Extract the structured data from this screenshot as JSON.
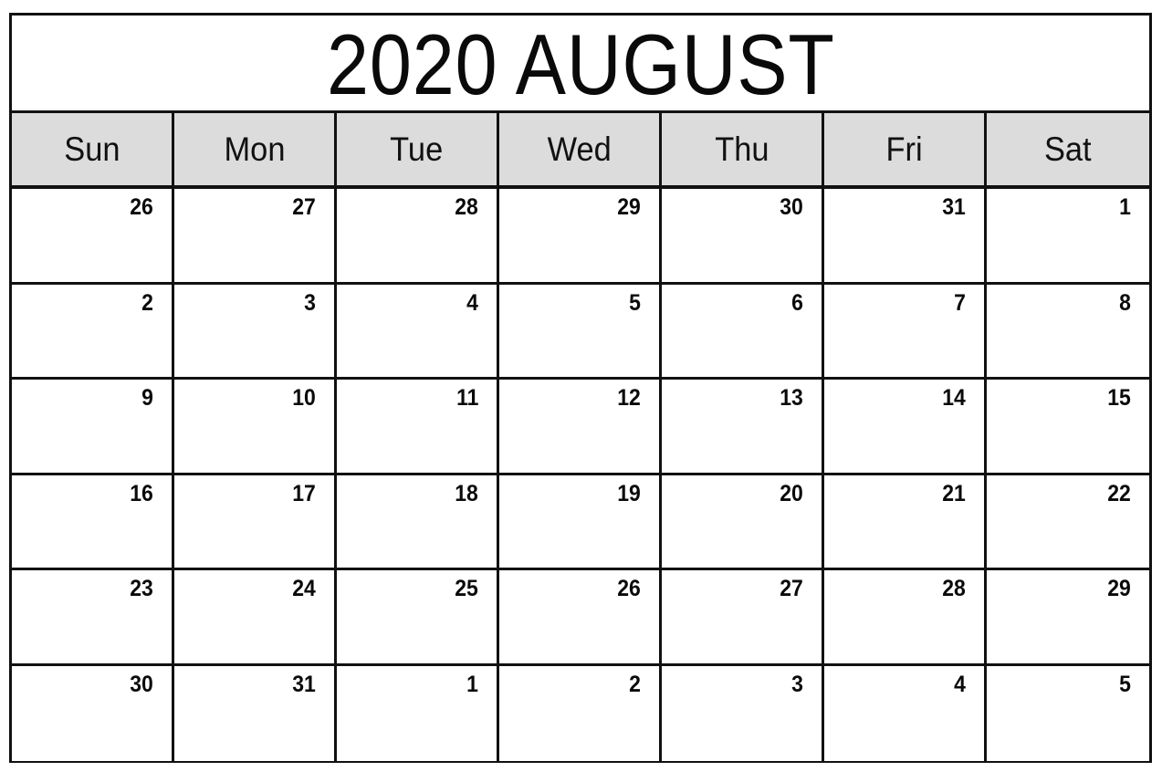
{
  "document": {
    "type": "printable-monthly-calendar",
    "title": "2020 AUGUST",
    "year": "2020",
    "month": "AUGUST"
  },
  "colors": {
    "header_background": "#dcdcdc",
    "grid_line": "#111111",
    "cell_background": "#ffffff",
    "text": "#0a0a0a"
  },
  "weekdays": [
    {
      "label": "Sun"
    },
    {
      "label": "Mon"
    },
    {
      "label": "Tue"
    },
    {
      "label": "Wed"
    },
    {
      "label": "Thu"
    },
    {
      "label": "Fri"
    },
    {
      "label": "Sat"
    }
  ],
  "weeks": [
    {
      "days": [
        {
          "number": "26"
        },
        {
          "number": "27"
        },
        {
          "number": "28"
        },
        {
          "number": "29"
        },
        {
          "number": "30"
        },
        {
          "number": "31"
        },
        {
          "number": "1"
        }
      ]
    },
    {
      "days": [
        {
          "number": "2"
        },
        {
          "number": "3"
        },
        {
          "number": "4"
        },
        {
          "number": "5"
        },
        {
          "number": "6"
        },
        {
          "number": "7"
        },
        {
          "number": "8"
        }
      ]
    },
    {
      "days": [
        {
          "number": "9"
        },
        {
          "number": "10"
        },
        {
          "number": "11"
        },
        {
          "number": "12"
        },
        {
          "number": "13"
        },
        {
          "number": "14"
        },
        {
          "number": "15"
        }
      ]
    },
    {
      "days": [
        {
          "number": "16"
        },
        {
          "number": "17"
        },
        {
          "number": "18"
        },
        {
          "number": "19"
        },
        {
          "number": "20"
        },
        {
          "number": "21"
        },
        {
          "number": "22"
        }
      ]
    },
    {
      "days": [
        {
          "number": "23"
        },
        {
          "number": "24"
        },
        {
          "number": "25"
        },
        {
          "number": "26"
        },
        {
          "number": "27"
        },
        {
          "number": "28"
        },
        {
          "number": "29"
        }
      ]
    },
    {
      "days": [
        {
          "number": "30"
        },
        {
          "number": "31"
        },
        {
          "number": "1"
        },
        {
          "number": "2"
        },
        {
          "number": "3"
        },
        {
          "number": "4"
        },
        {
          "number": "5"
        }
      ]
    }
  ]
}
